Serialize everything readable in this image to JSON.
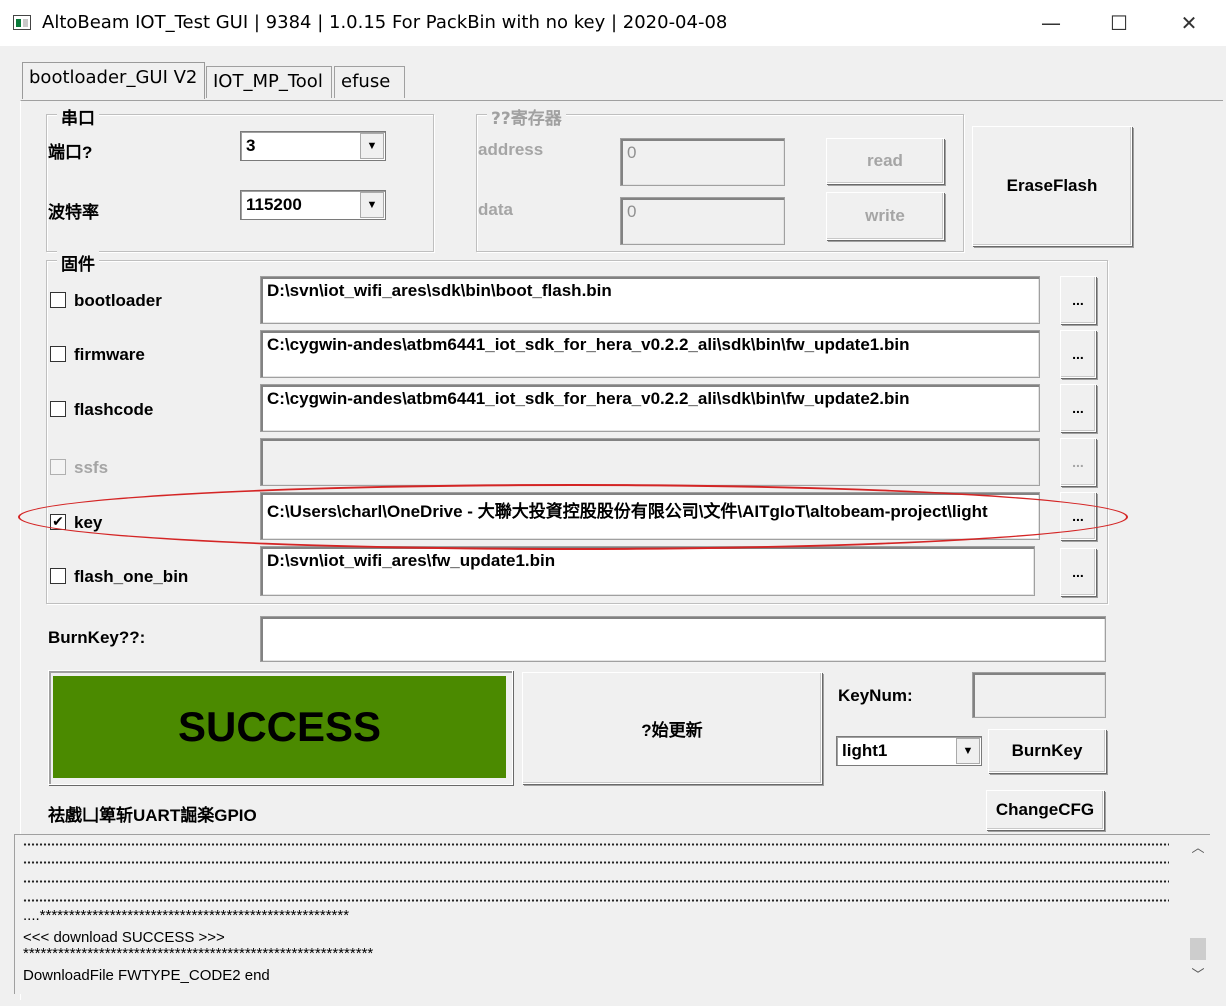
{
  "window": {
    "title": "AltoBeam IOT_Test GUI  | 9384 | 1.0.15 For PackBin with no key | 2020-04-08",
    "minimize_glyph": "—",
    "maximize_glyph": "☐",
    "close_glyph": "✕"
  },
  "tabs": [
    {
      "label": "bootloader_GUI V2",
      "active": true
    },
    {
      "label": "IOT_MP_Tool",
      "active": false
    },
    {
      "label": "efuse",
      "active": false
    }
  ],
  "serial": {
    "group_label": "串口",
    "port_label": "端口?",
    "port_value": "3",
    "baud_label": "波特率",
    "baud_value": "115200"
  },
  "register": {
    "group_label": "??寄存器",
    "address_label": "address",
    "address_value": "0",
    "data_label": "data",
    "data_value": "0",
    "read_label": "read",
    "write_label": "write"
  },
  "erase_flash_label": "EraseFlash",
  "firmware": {
    "group_label": "固件",
    "browse_label": "...",
    "rows": [
      {
        "label": "bootloader",
        "checked": false,
        "enabled": true,
        "path": "D:\\svn\\iot_wifi_ares\\sdk\\bin\\boot_flash.bin"
      },
      {
        "label": "firmware",
        "checked": false,
        "enabled": true,
        "path": "C:\\cygwin-andes\\atbm6441_iot_sdk_for_hera_v0.2.2_ali\\sdk\\bin\\fw_update1.bin"
      },
      {
        "label": "flashcode",
        "checked": false,
        "enabled": true,
        "path": "C:\\cygwin-andes\\atbm6441_iot_sdk_for_hera_v0.2.2_ali\\sdk\\bin\\fw_update2.bin"
      },
      {
        "label": "ssfs",
        "checked": false,
        "enabled": false,
        "path": ""
      },
      {
        "label": "key",
        "checked": true,
        "enabled": true,
        "path": "C:\\Users\\charl\\OneDrive - 大聯大投資控股股份有限公司\\文件\\AITgIoT\\altobeam-project\\light"
      },
      {
        "label": "flash_one_bin",
        "checked": false,
        "enabled": true,
        "path": "D:\\svn\\iot_wifi_ares\\fw_update1.bin"
      }
    ]
  },
  "burnkey": {
    "label": "BurnKey??:",
    "value": ""
  },
  "status": {
    "text": "SUCCESS",
    "color": "#4b8a00"
  },
  "start_update_label": "?始更新",
  "keynum": {
    "label": "KeyNum:",
    "value": "",
    "select_value": "light1",
    "burnkey_button": "BurnKey"
  },
  "hint_text": "祛戲凵箄斩UART誳楽GPIO",
  "changecfg_label": "ChangeCFG",
  "log": {
    "line_stars": "....*****************************************************",
    "line_success": "<<<   download SUCCESS    >>>",
    "line_stars2": "************************************************************",
    "line_end": "DownloadFile FWTYPE_CODE2 end"
  },
  "scroll": {
    "up": "︿",
    "down": "﹀"
  }
}
